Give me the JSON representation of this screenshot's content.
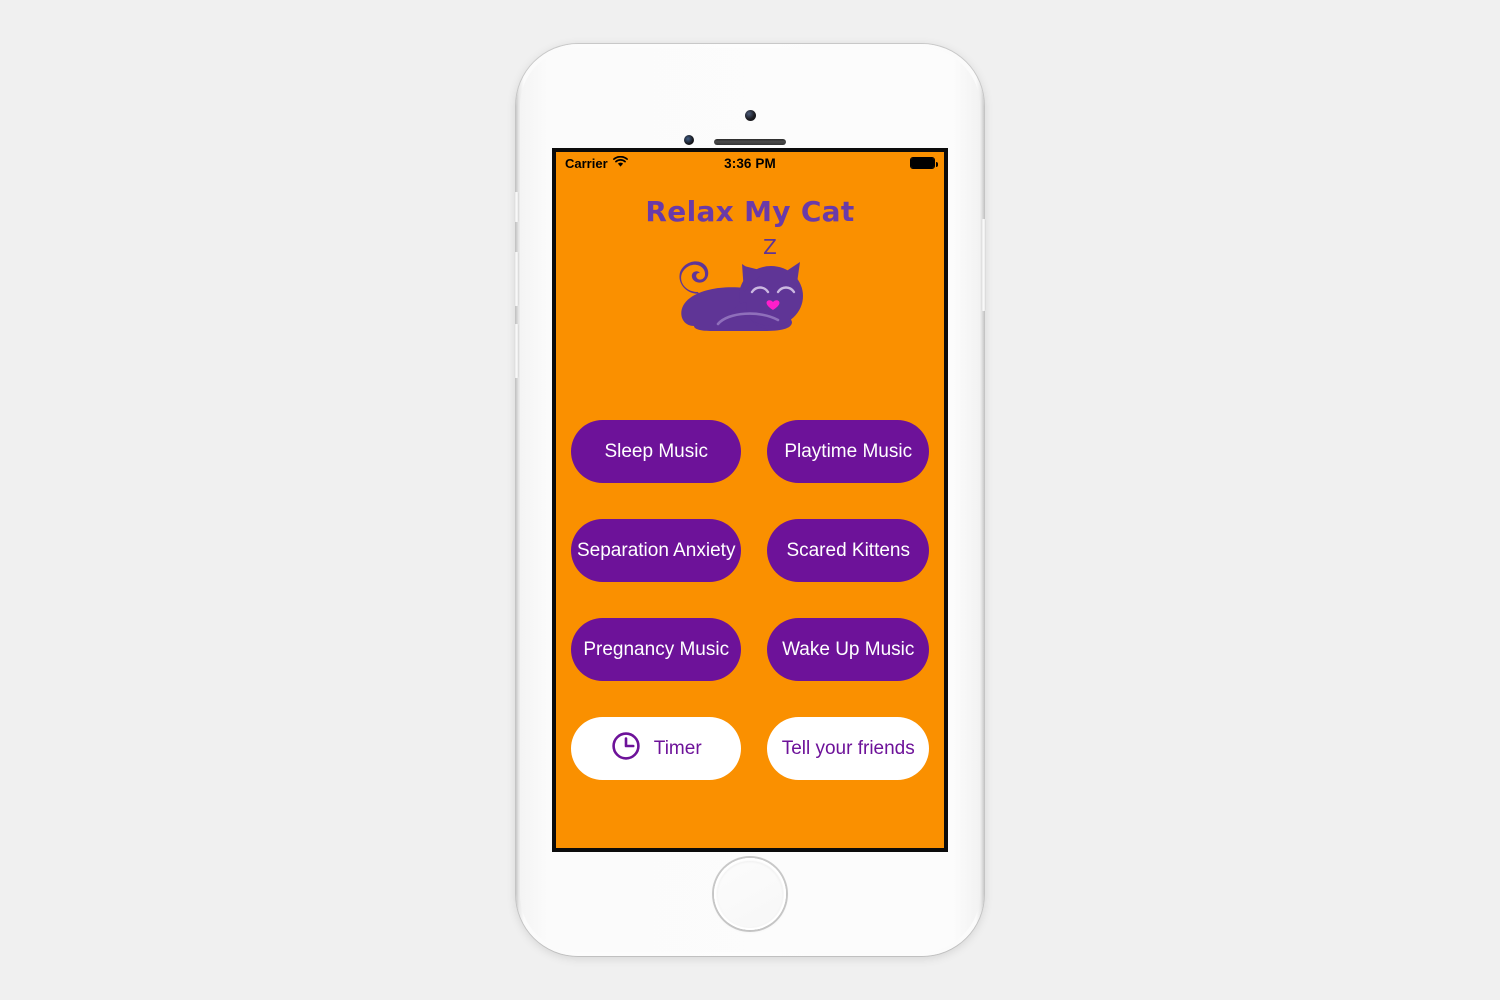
{
  "canvas": {
    "background_color": "#f0f0f0"
  },
  "device": {
    "name": "iPhone",
    "body_color": "#fcfcfc",
    "hardware": {
      "front_camera": "front-camera",
      "proximity_sensor": "proximity-sensor",
      "earpiece_speaker": "earpiece-speaker",
      "home_button": "home-button",
      "mute_switch": "mute-switch",
      "volume_up": "volume-up",
      "volume_down": "volume-down",
      "power_button": "power-button"
    }
  },
  "status_bar": {
    "carrier": "Carrier",
    "wifi_icon": "wifi-icon",
    "time": "3:36 PM",
    "battery_icon": "battery-full-icon"
  },
  "app": {
    "title": "Relax My Cat",
    "title_color": "#6a3aa8",
    "background_color": "#fa9000",
    "accent_color": "#6d1299",
    "nose_color": "#ff1ecb",
    "logo": {
      "name": "sleeping-cat-logo",
      "sleep_letter": "Z",
      "body_color": "#5f3596",
      "highlight_color": "#8f6fbb"
    }
  },
  "buttons": [
    {
      "label": "Sleep Music",
      "style": "primary",
      "icon": null
    },
    {
      "label": "Playtime Music",
      "style": "primary",
      "icon": null
    },
    {
      "label": "Separation Anxiety",
      "style": "primary",
      "icon": null
    },
    {
      "label": "Scared Kittens",
      "style": "primary",
      "icon": null
    },
    {
      "label": "Pregnancy Music",
      "style": "primary",
      "icon": null
    },
    {
      "label": "Wake Up Music",
      "style": "primary",
      "icon": null
    },
    {
      "label": "Timer",
      "style": "secondary",
      "icon": "clock-icon"
    },
    {
      "label": "Tell your friends",
      "style": "secondary",
      "icon": null
    }
  ]
}
